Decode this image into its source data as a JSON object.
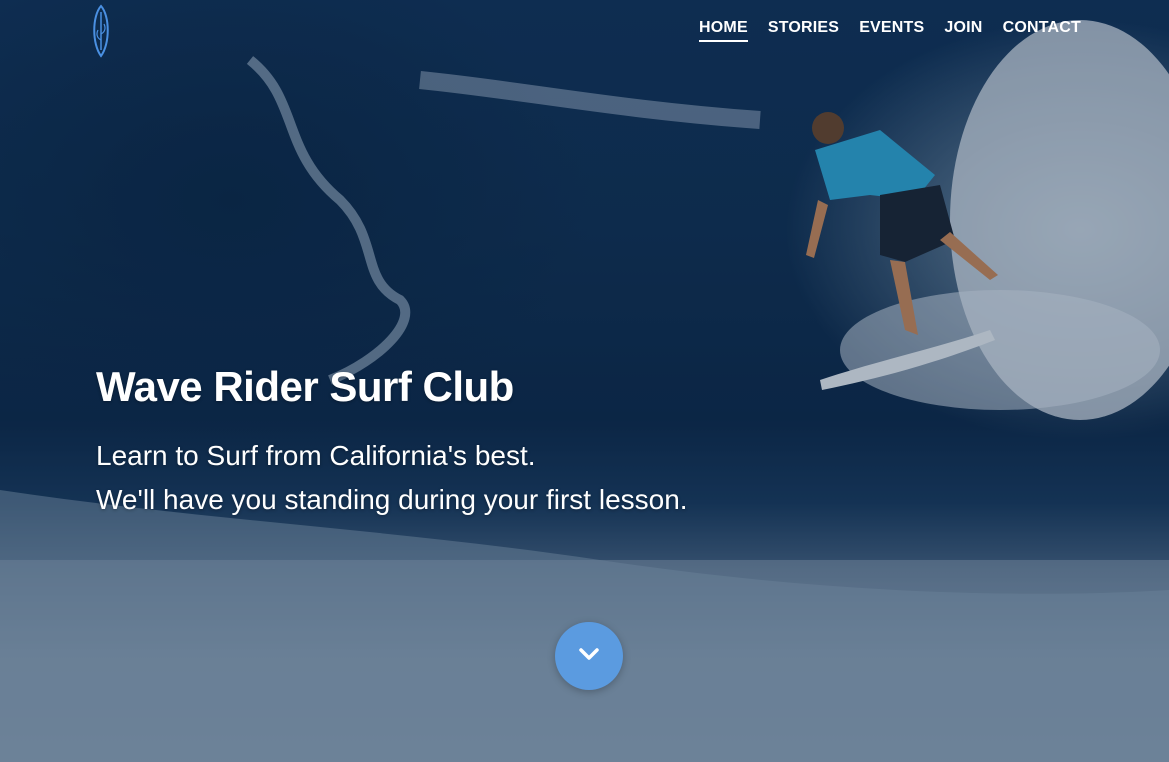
{
  "nav": {
    "logo_icon": "surfboard-icon",
    "links": [
      {
        "label": "HOME",
        "active": true
      },
      {
        "label": "STORIES",
        "active": false
      },
      {
        "label": "EVENTS",
        "active": false
      },
      {
        "label": "JOIN",
        "active": false
      },
      {
        "label": "CONTACT",
        "active": false
      }
    ]
  },
  "hero": {
    "title": "Wave Rider Surf Club",
    "subtitle_line1": "Learn to Surf from California's best.",
    "subtitle_line2": "We'll have you standing during your first lesson.",
    "background_image": "surfer-riding-wave-photo",
    "scroll_button_icon": "chevron-down-icon"
  },
  "colors": {
    "accent": "#5b9be0",
    "logo_stroke": "#4a90e2",
    "text": "#ffffff"
  }
}
